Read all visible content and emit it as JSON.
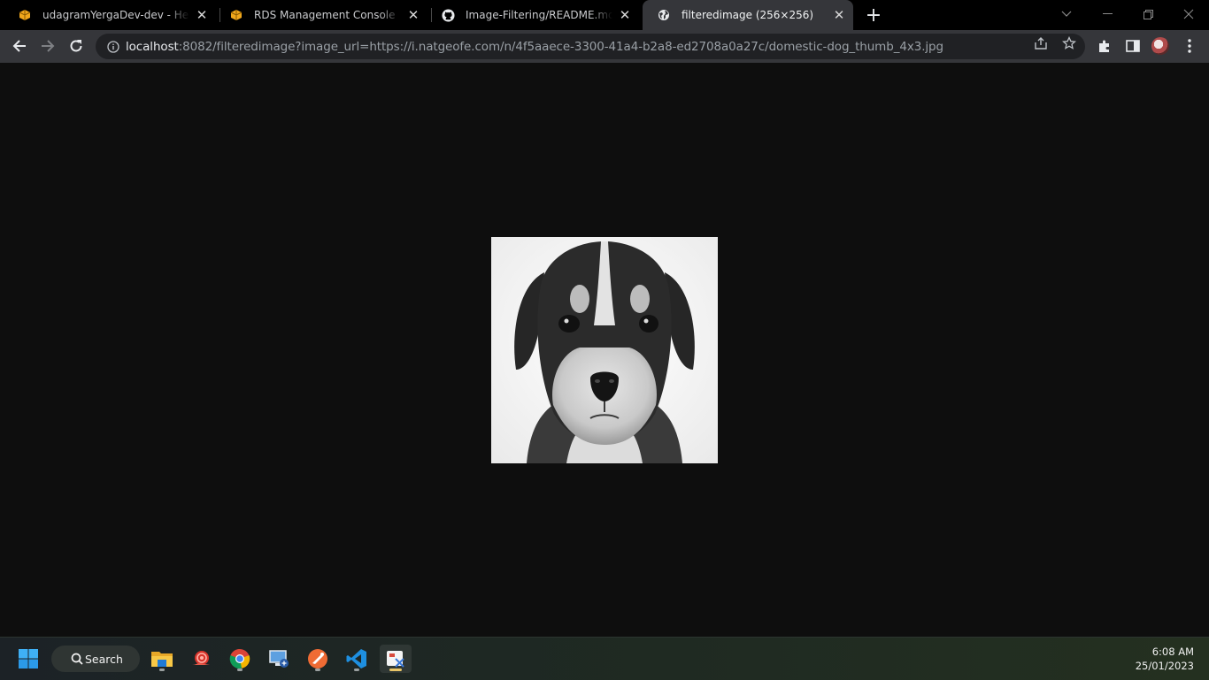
{
  "browser": {
    "tabs": [
      {
        "title": "udagramYergaDev-dev - Health D",
        "icon": "aws-box-icon",
        "active": false
      },
      {
        "title": "RDS Management Console",
        "icon": "aws-box-icon",
        "active": false
      },
      {
        "title": "Image-Filtering/README.md at m",
        "icon": "github-icon",
        "active": false
      },
      {
        "title": "filteredimage (256×256)",
        "icon": "globe-icon",
        "active": true
      }
    ],
    "new_tab_label": "+",
    "address": {
      "host": "localhost",
      "rest": ":8082/filteredimage?image_url=https://i.natgeofe.com/n/4f5aaece-3300-41a4-b2a8-ed2708a0a27c/domestic-dog_thumb_4x3.jpg"
    }
  },
  "content": {
    "image_alt": "grayscale puppy photo",
    "image_size": "256×256"
  },
  "taskbar": {
    "search_label": "Search",
    "apps": [
      "file-explorer-icon",
      "snail-app-icon",
      "chrome-icon",
      "remote-desktop-icon",
      "postman-icon",
      "vscode-icon",
      "snipping-tool-icon"
    ],
    "time": "6:08 AM",
    "date": "25/01/2023"
  },
  "colors": {
    "tabstrip_bg": "#000000",
    "toolbar_bg": "#35363a",
    "page_bg": "#0e0e0e",
    "taskbar_bg": "#1f2a22"
  }
}
